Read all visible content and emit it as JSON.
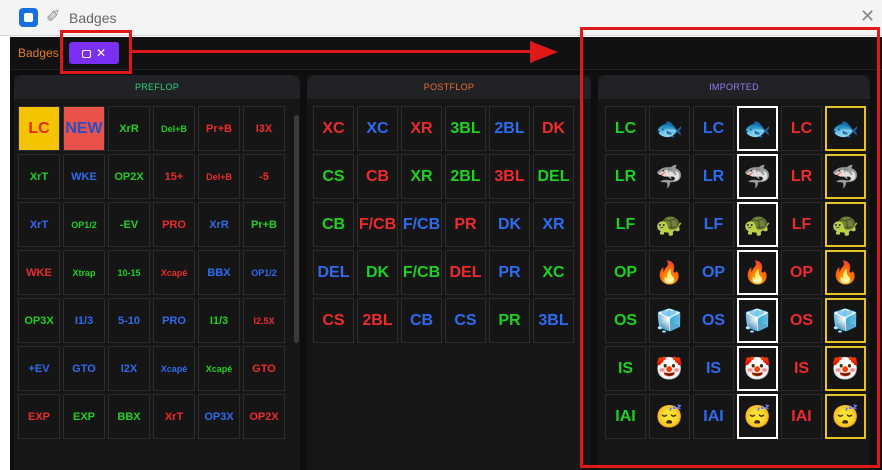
{
  "window": {
    "title": "Badges",
    "close_glyph": "✕"
  },
  "toolbar": {
    "label": "Badges",
    "import_button_label": "✕"
  },
  "colors": {
    "green": "#1ed11e",
    "blue": "#2d6cf0",
    "red": "#ee2b2b",
    "accent": "#7b2ff0",
    "annotation": "#e01818"
  },
  "columns": {
    "preflop": {
      "header": "PREFLOP",
      "header_color": "#2fd17a",
      "cells": [
        {
          "t": "LC",
          "c": "#e8281b",
          "bg": "#f5c400",
          "size": "l"
        },
        {
          "t": "NEW",
          "c": "#2d4ec0",
          "bg": "#e8524a",
          "size": "l"
        },
        {
          "t": "XrR",
          "c": "#1ed11e",
          "size": "s"
        },
        {
          "t": "Del+B",
          "c": "#1ed11e",
          "size": "xs"
        },
        {
          "t": "Pr+B",
          "c": "#ee2b2b",
          "size": "s"
        },
        {
          "t": "I3X",
          "c": "#ee2b2b",
          "size": "s"
        },
        {
          "t": "XrT",
          "c": "#1ed11e",
          "size": "s"
        },
        {
          "t": "WKE",
          "c": "#2d6cf0",
          "size": "s"
        },
        {
          "t": "OP2X",
          "c": "#1ed11e",
          "size": "s"
        },
        {
          "t": "15+",
          "c": "#ee2b2b",
          "size": "s"
        },
        {
          "t": "Del+B",
          "c": "#ee2b2b",
          "size": "xs"
        },
        {
          "t": "-5",
          "c": "#ee2b2b",
          "size": "s"
        },
        {
          "t": "XrT",
          "c": "#2d6cf0",
          "size": "s"
        },
        {
          "t": "OP1/2",
          "c": "#1ed11e",
          "size": "xs"
        },
        {
          "t": "-EV",
          "c": "#1ed11e",
          "size": "s"
        },
        {
          "t": "PRO",
          "c": "#ee2b2b",
          "size": "s"
        },
        {
          "t": "XrR",
          "c": "#2d6cf0",
          "size": "s"
        },
        {
          "t": "Pr+B",
          "c": "#1ed11e",
          "size": "s"
        },
        {
          "t": "WKE",
          "c": "#ee2b2b",
          "size": "s"
        },
        {
          "t": "Xtrap",
          "c": "#1ed11e",
          "size": "xs"
        },
        {
          "t": "10-15",
          "c": "#1ed11e",
          "size": "xs"
        },
        {
          "t": "Xcapé",
          "c": "#ee2b2b",
          "size": "xs"
        },
        {
          "t": "BBX",
          "c": "#2d6cf0",
          "size": "s"
        },
        {
          "t": "OP1/2",
          "c": "#2d6cf0",
          "size": "xs"
        },
        {
          "t": "OP3X",
          "c": "#1ed11e",
          "size": "s"
        },
        {
          "t": "I1/3",
          "c": "#2d6cf0",
          "size": "s"
        },
        {
          "t": "5-10",
          "c": "#2d6cf0",
          "size": "s"
        },
        {
          "t": "PRO",
          "c": "#2d6cf0",
          "size": "s"
        },
        {
          "t": "I1/3",
          "c": "#1ed11e",
          "size": "s"
        },
        {
          "t": "I2.5X",
          "c": "#ee2b2b",
          "size": "xs"
        },
        {
          "t": "+EV",
          "c": "#2d6cf0",
          "size": "s"
        },
        {
          "t": "GTO",
          "c": "#2d6cf0",
          "size": "s"
        },
        {
          "t": "I2X",
          "c": "#2d6cf0",
          "size": "s"
        },
        {
          "t": "Xcapé",
          "c": "#2d6cf0",
          "size": "xs"
        },
        {
          "t": "Xcapé",
          "c": "#1ed11e",
          "size": "xs"
        },
        {
          "t": "GTO",
          "c": "#ee2b2b",
          "size": "s"
        },
        {
          "t": "EXP",
          "c": "#ee2b2b",
          "size": "s"
        },
        {
          "t": "EXP",
          "c": "#1ed11e",
          "size": "s"
        },
        {
          "t": "BBX",
          "c": "#1ed11e",
          "size": "s"
        },
        {
          "t": "XrT",
          "c": "#ee2b2b",
          "size": "s"
        },
        {
          "t": "OP3X",
          "c": "#2d6cf0",
          "size": "s"
        },
        {
          "t": "OP2X",
          "c": "#ee2b2b",
          "size": "s"
        }
      ]
    },
    "postflop": {
      "header": "POSTFLOP",
      "header_color": "#ee6b2b",
      "cells": [
        {
          "t": "XC",
          "c": "#ee2b2b"
        },
        {
          "t": "XC",
          "c": "#2d6cf0"
        },
        {
          "t": "XR",
          "c": "#ee2b2b"
        },
        {
          "t": "3BL",
          "c": "#1ed11e"
        },
        {
          "t": "2BL",
          "c": "#2d6cf0"
        },
        {
          "t": "DK",
          "c": "#ee2b2b"
        },
        {
          "t": "CS",
          "c": "#1ed11e"
        },
        {
          "t": "CB",
          "c": "#ee2b2b"
        },
        {
          "t": "XR",
          "c": "#1ed11e"
        },
        {
          "t": "2BL",
          "c": "#1ed11e"
        },
        {
          "t": "3BL",
          "c": "#ee2b2b"
        },
        {
          "t": "DEL",
          "c": "#1ed11e"
        },
        {
          "t": "CB",
          "c": "#1ed11e"
        },
        {
          "t": "F/CB",
          "c": "#ee2b2b"
        },
        {
          "t": "F/CB",
          "c": "#2d6cf0"
        },
        {
          "t": "PR",
          "c": "#ee2b2b"
        },
        {
          "t": "DK",
          "c": "#2d6cf0"
        },
        {
          "t": "XR",
          "c": "#2d6cf0"
        },
        {
          "t": "DEL",
          "c": "#2d6cf0"
        },
        {
          "t": "DK",
          "c": "#1ed11e"
        },
        {
          "t": "F/CB",
          "c": "#1ed11e"
        },
        {
          "t": "DEL",
          "c": "#ee2b2b"
        },
        {
          "t": "PR",
          "c": "#2d6cf0"
        },
        {
          "t": "XC",
          "c": "#1ed11e"
        },
        {
          "t": "CS",
          "c": "#ee2b2b"
        },
        {
          "t": "2BL",
          "c": "#ee2b2b"
        },
        {
          "t": "CB",
          "c": "#2d6cf0"
        },
        {
          "t": "CS",
          "c": "#2d6cf0"
        },
        {
          "t": "PR",
          "c": "#1ed11e"
        },
        {
          "t": "3BL",
          "c": "#2d6cf0"
        }
      ]
    },
    "imported": {
      "header": "IMPORTED",
      "header_color": "#9b7bf5",
      "rows": [
        {
          "code": "LC",
          "emoji": "🐟",
          "icon": "fish-icon"
        },
        {
          "code": "LR",
          "emoji": "🦈",
          "icon": "shark-icon"
        },
        {
          "code": "LF",
          "emoji": "🐢",
          "icon": "turtle-icon"
        },
        {
          "code": "OP",
          "emoji": "🔥",
          "icon": "fire-icon"
        },
        {
          "code": "OS",
          "emoji": "🧊",
          "icon": "ice-cube-icon"
        },
        {
          "code": "IS",
          "emoji": "🤡",
          "icon": "clown-icon"
        },
        {
          "code": "IAI",
          "emoji": "😴",
          "icon": "sleepy-face-icon"
        }
      ],
      "row_colors": [
        "#1ed11e",
        "#2d6cf0",
        "#ee2b2b"
      ]
    }
  }
}
